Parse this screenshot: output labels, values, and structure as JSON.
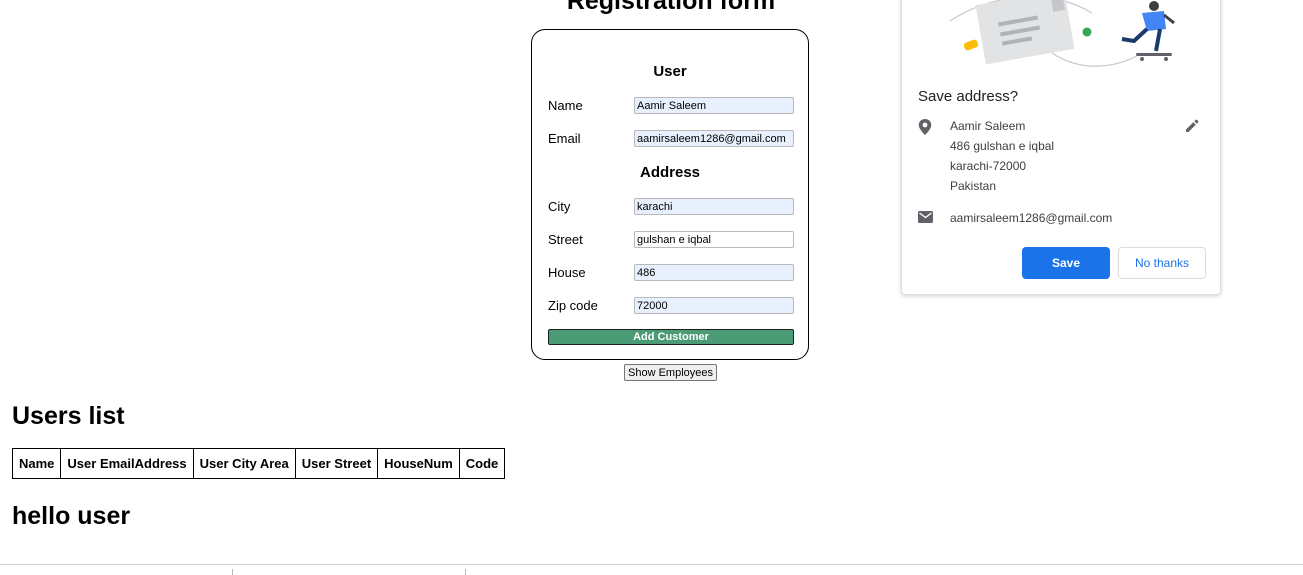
{
  "form": {
    "title": "Registration form",
    "user_section": "User",
    "address_section": "Address",
    "fields": {
      "name": {
        "label": "Name",
        "value": "Aamir Saleem"
      },
      "email": {
        "label": "Email",
        "value": "aamirsaleem1286@gmail.com"
      },
      "city": {
        "label": "City",
        "value": "karachi"
      },
      "street": {
        "label": "Street",
        "value": "gulshan e iqbal"
      },
      "house": {
        "label": "House",
        "value": "486"
      },
      "zip": {
        "label": "Zip code",
        "value": "72000"
      }
    },
    "add_button": "Add Customer",
    "add_button_color": "#4a9b76"
  },
  "show_employees_button": "Show Employees",
  "users": {
    "heading": "Users list",
    "columns": [
      "Name",
      "User EmailAddress",
      "User City Area",
      "User Street",
      "HouseNum",
      "Code"
    ]
  },
  "hello_heading": "hello user",
  "save_address_popup": {
    "title": "Save address?",
    "address_lines": [
      "Aamir Saleem",
      "486 gulshan e iqbal",
      "karachi-72000",
      "Pakistan"
    ],
    "email": "aamirsaleem1286@gmail.com",
    "save_label": "Save",
    "no_thanks_label": "No thanks",
    "accent_color": "#1a73e8",
    "icons": [
      "location-pin-icon",
      "edit-pencil-icon",
      "email-icon"
    ]
  }
}
